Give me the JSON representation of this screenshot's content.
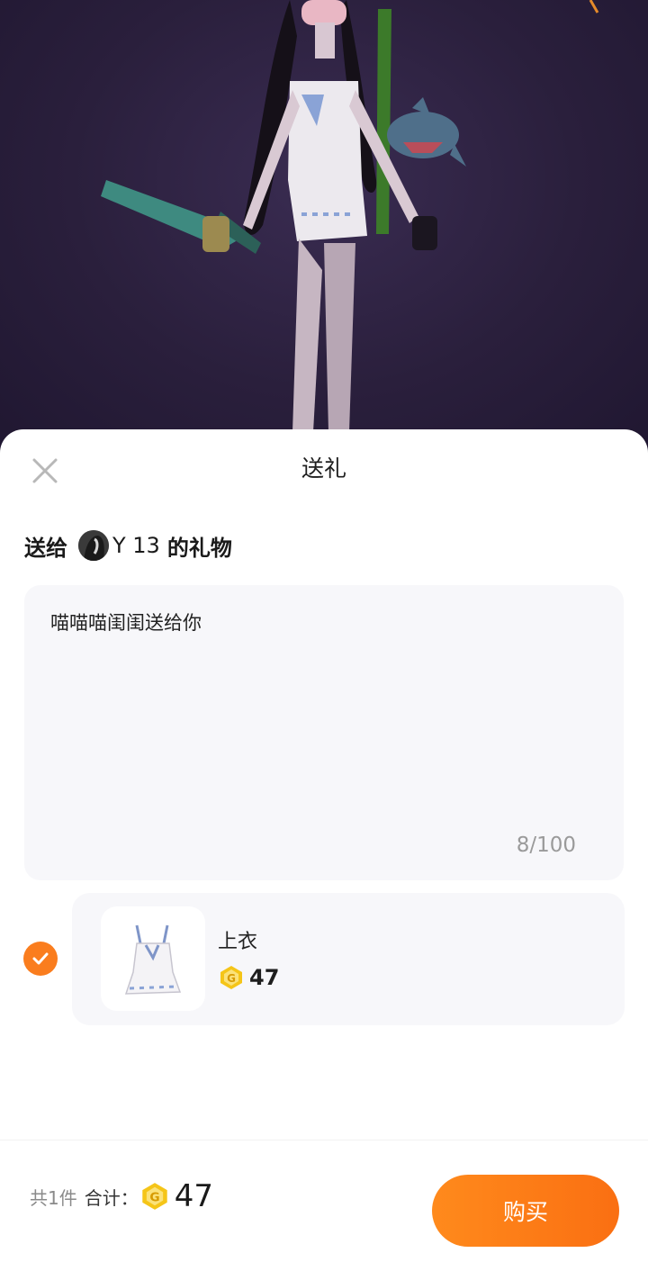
{
  "sheet": {
    "title": "送礼",
    "close_icon": "close-icon"
  },
  "recipient": {
    "prefix": "送给",
    "name": "Y 13",
    "suffix": "的礼物"
  },
  "message": {
    "text": "喵喵喵闺闺送给你",
    "count": "8/100"
  },
  "item": {
    "selected": true,
    "name": "上衣",
    "price": "47",
    "coin_icon": "coin-icon"
  },
  "footer": {
    "count_label": "共1件",
    "total_label": "合计：",
    "total_amount": "47",
    "buy_label": "购买"
  },
  "colors": {
    "accent": "#fa7d1e",
    "coin": "#f5c518",
    "preview_bg": "#2a1f3c"
  }
}
